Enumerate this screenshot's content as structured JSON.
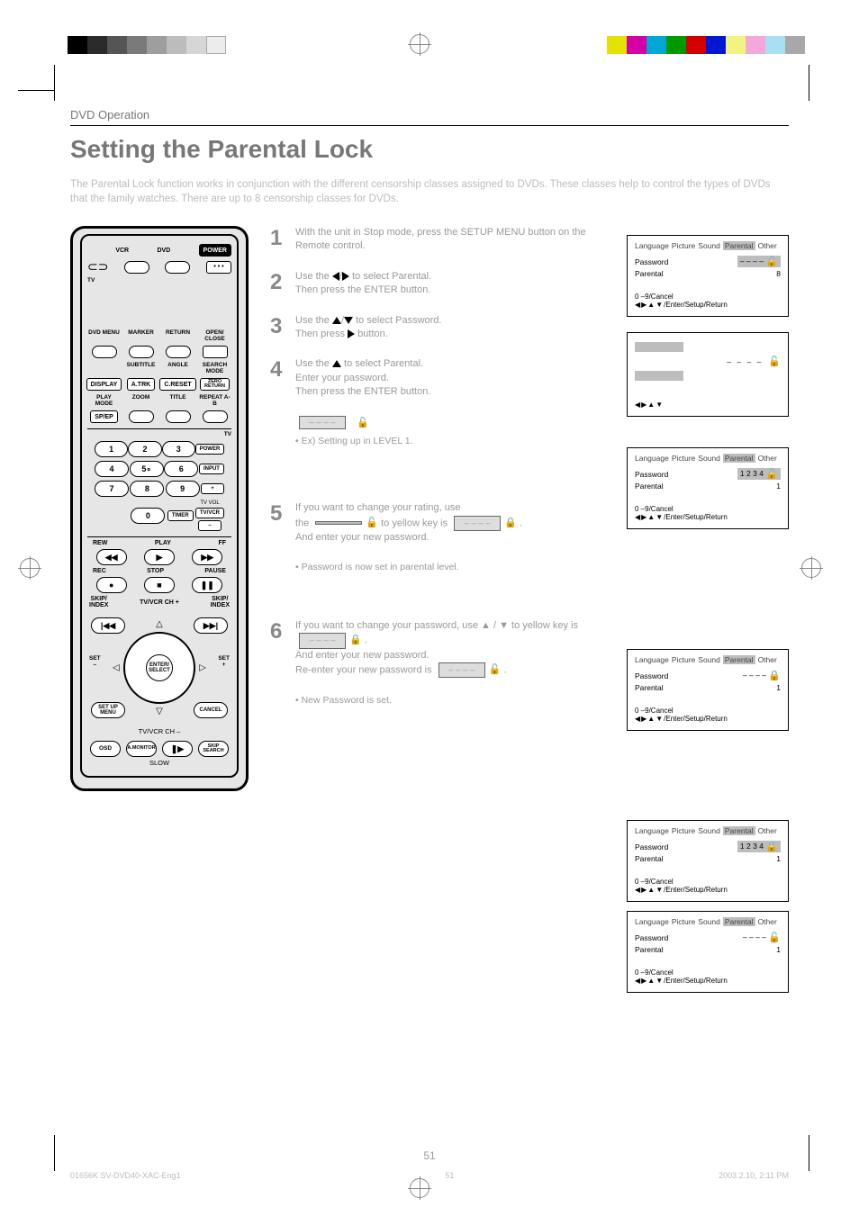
{
  "running_head": "DVD Operation",
  "main_title": "Setting the Parental Lock",
  "intro": "The Parental Lock function works in conjunction with the different censorship classes assigned to DVDs. These classes help to control the types of DVDs that the family watches. There are up to 8 censorship classes for DVDs.",
  "page_number": "51",
  "footer": {
    "left": "01656K SV-DVD40-XAC-Eng1",
    "center": "51",
    "right": "2003.2.10, 2:11 PM"
  },
  "remote": {
    "vcr": "VCR",
    "dvd": "DVD",
    "power": "POWER",
    "tv": "TV",
    "row1": [
      "DVD MENU",
      "MARKER",
      "RETURN",
      "OPEN/\nCLOSE"
    ],
    "row2_lab": [
      "",
      "SUBTITLE",
      "ANGLE",
      "SEARCH\nMODE"
    ],
    "row2": [
      "DISPLAY",
      "A.TRK",
      "C.RESET",
      "ZERO\nRETURN"
    ],
    "row3_lab": [
      "PLAY MODE",
      "ZOOM",
      "TITLE",
      "REPEAT A-B"
    ],
    "row3": [
      "SP/EP",
      "",
      "",
      ""
    ],
    "tv_side": "TV",
    "nums": [
      "1",
      "2",
      "3",
      "4",
      "5",
      "6",
      "7",
      "8",
      "9",
      "0"
    ],
    "power_small": "POWER",
    "input": "INPUT",
    "tvvol": "TV VOL",
    "plus": "+",
    "minus": "–",
    "timer": "TIMER",
    "tvvcr": "TV/VCR",
    "rew": "REW",
    "play": "PLAY",
    "ff": "FF",
    "rec": "REC",
    "stop": "STOP",
    "pause": "PAUSE",
    "skip_index": "SKIP/\nINDEX",
    "tvvcr_ch": "TV/VCR CH",
    "set_minus": "SET\n–",
    "set_plus": "SET\n+",
    "enter": "ENTER/\nSELECT",
    "setup": "SET UP\nMENU",
    "cancel": "CANCEL",
    "osd": "OSD",
    "amonitor": "A.MONITOR",
    "slow": "SLOW",
    "skip_search": "SKIP\nSEARCH"
  },
  "steps": [
    {
      "n": "1",
      "text": "With the unit in Stop mode, press the SETUP MENU button on the Remote control."
    },
    {
      "n": "2",
      "text": "Use the ◀/▶ to select Parental. Then press the ENTER button."
    },
    {
      "n": "3",
      "text": "Use the ▲/▼ to select Password. Then press ▶ button."
    },
    {
      "n": "4",
      "text": "Use the ▲ to select Parental. Enter your password. Then press the ENTER button."
    },
    {
      "headline_hint": "Ex) Setting up in LEVEL 1."
    },
    {
      "n": "5",
      "text_parts": [
        "If you want to change your rating, use the ",
        " to yellow key is ",
        " .",
        "And enter your new password."
      ],
      "box_a": "            ",
      "box_b": "– – – –"
    },
    {
      "hint": "Password is now set in parental level."
    },
    {
      "n": "6",
      "text_parts": [
        "If you want to change your password, use ▲ / ▼ to yellow key is ",
        " . And enter your new password. Re-enter your new password is ",
        " ."
      ],
      "box_a": "– – – –",
      "box_b": "– – – –"
    },
    {
      "hint": "New Password is set."
    }
  ],
  "pw_row": {
    "dashes": "– – – –",
    "lock": "🔓"
  },
  "osd_common": {
    "tabs": [
      "Language",
      "Picture",
      "Sound",
      "Parental",
      "Other"
    ],
    "password": "Password",
    "parental": "Parental",
    "hint": "0 –9/Cancel",
    "nav": "◀▶▲▼/Enter/Setup/Return",
    "nav_short": "◀▶▲▼"
  },
  "osd1": {
    "pw_val": "– – – –",
    "lock": "🔓",
    "par_val": "8",
    "val_sel": "pw"
  },
  "osd2_simple": {
    "dashes": "– – – –",
    "lock": "🔓"
  },
  "osd3": {
    "pw_val": "1 2 3 4",
    "lock": "🔓",
    "par_val": "1",
    "val_sel": "pw"
  },
  "osd4": {
    "pw_val": "– – – –",
    "lock": "🔒",
    "par_val": "1",
    "val_sel": "none"
  },
  "osd5": {
    "pw_val": "1 2 3 4",
    "lock": "🔒",
    "par_val": "1",
    "val_sel": "pw"
  },
  "osd6": {
    "pw_val": "– – – –",
    "lock": "🔓",
    "par_val": "1",
    "val_sel": "none"
  },
  "small_heading": ""
}
